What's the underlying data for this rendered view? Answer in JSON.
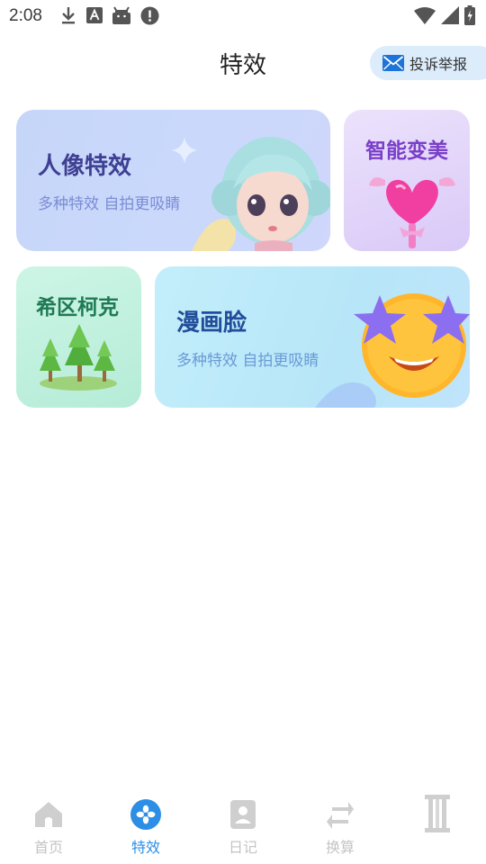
{
  "status_bar": {
    "time": "2:08",
    "left_icons": [
      "download-icon",
      "font-a-icon",
      "android-icon",
      "alert-icon"
    ],
    "right_icons": [
      "wifi-icon",
      "signal-icon",
      "battery-icon"
    ]
  },
  "header": {
    "title": "特效",
    "report_button": {
      "label": "投诉举报",
      "icon": "mail-icon"
    }
  },
  "cards": {
    "portrait": {
      "title": "人像特效",
      "subtitle": "多种特效 自拍更吸睛"
    },
    "beauty": {
      "title": "智能变美"
    },
    "forest": {
      "title": "希区柯克"
    },
    "comic": {
      "title": "漫画脸",
      "subtitle": "多种特效 自拍更吸睛"
    }
  },
  "bottom_nav": {
    "items": [
      {
        "label": "首页",
        "icon": "home-icon",
        "active": false
      },
      {
        "label": "特效",
        "icon": "effects-icon",
        "active": true
      },
      {
        "label": "日记",
        "icon": "diary-icon",
        "active": false
      },
      {
        "label": "换算",
        "icon": "convert-icon",
        "active": false
      },
      {
        "label": "",
        "icon": "pillar-icon",
        "active": false
      }
    ]
  },
  "colors": {
    "accent": "#2d8ee6",
    "inactive_nav": "#c4c4c4",
    "portrait_title": "#3e3f93",
    "beauty_title": "#7a3fc8",
    "forest_title": "#1f7a55",
    "comic_title": "#214d9a"
  }
}
